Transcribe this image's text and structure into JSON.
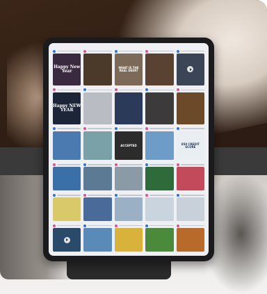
{
  "tiles": [
    {
      "bg": "#3a2a40",
      "text": "Happy New Year",
      "style": "big",
      "dot": "blue"
    },
    {
      "bg": "#4b3a2a",
      "text": "",
      "style": "cap",
      "dot": "pink"
    },
    {
      "bg": "#7b6a58",
      "text": "WHAT IS THE REAL DEER?",
      "style": "cap",
      "dot": "blue"
    },
    {
      "bg": "#5a4232",
      "text": "",
      "style": "cap",
      "dot": "pink"
    },
    {
      "bg": "#3b4556",
      "text": "",
      "style": "play",
      "dot": "blue"
    },
    {
      "bg": "#1d2538",
      "text": "Happy NEW YEAR",
      "style": "big",
      "dot": "pink"
    },
    {
      "bg": "#b9bcc2",
      "text": "",
      "style": "cap",
      "dot": "blue"
    },
    {
      "bg": "#2b3a58",
      "text": "",
      "style": "cap",
      "dot": "pink"
    },
    {
      "bg": "#3c3a3a",
      "text": "",
      "style": "cap",
      "dot": "blue"
    },
    {
      "bg": "#6b4a2a",
      "text": "",
      "style": "cap",
      "dot": "pink"
    },
    {
      "bg": "#4a7ab0",
      "text": "",
      "style": "cap",
      "dot": "blue"
    },
    {
      "bg": "#7aa0a8",
      "text": "",
      "style": "cap",
      "dot": "pink"
    },
    {
      "bg": "#2c2c2c",
      "text": "ACCEPTED",
      "style": "cap",
      "dot": "blue"
    },
    {
      "bg": "#6d9cc8",
      "text": "",
      "style": "cap",
      "dot": "pink"
    },
    {
      "bg": "#e9eef2",
      "text": "850 CREDIT SCORE",
      "style": "dark",
      "dot": "blue"
    },
    {
      "bg": "#3a6fa8",
      "text": "",
      "style": "cap",
      "dot": "pink"
    },
    {
      "bg": "#5d7a94",
      "text": "",
      "style": "cap",
      "dot": "blue"
    },
    {
      "bg": "#8a9aa6",
      "text": "",
      "style": "cap",
      "dot": "pink"
    },
    {
      "bg": "#2e6a3a",
      "text": "",
      "style": "cap",
      "dot": "blue"
    },
    {
      "bg": "#c24a5a",
      "text": "",
      "style": "cap",
      "dot": "pink"
    },
    {
      "bg": "#d9c96a",
      "text": "",
      "style": "cap",
      "dot": "blue"
    },
    {
      "bg": "#4a6a9a",
      "text": "",
      "style": "cap",
      "dot": "pink"
    },
    {
      "bg": "#9ab0c4",
      "text": "",
      "style": "cap",
      "dot": "blue"
    },
    {
      "bg": "#c9d4de",
      "text": "",
      "style": "cap",
      "dot": "pink"
    },
    {
      "bg": "#c8d0da",
      "text": "",
      "style": "cap",
      "dot": "blue"
    },
    {
      "bg": "#2a4a6a",
      "text": "",
      "style": "play",
      "dot": "pink"
    },
    {
      "bg": "#5a8ab8",
      "text": "",
      "style": "cap",
      "dot": "blue"
    },
    {
      "bg": "#d8b23a",
      "text": "",
      "style": "cap",
      "dot": "pink"
    },
    {
      "bg": "#4a8a3a",
      "text": "",
      "style": "cap",
      "dot": "blue"
    },
    {
      "bg": "#b86a2a",
      "text": "",
      "style": "cap",
      "dot": "pink"
    }
  ]
}
